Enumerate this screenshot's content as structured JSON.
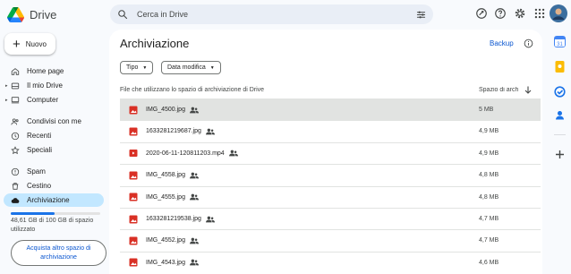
{
  "app": {
    "name": "Drive"
  },
  "search": {
    "placeholder": "Cerca in Drive"
  },
  "sidebar": {
    "new_label": "Nuovo",
    "items": [
      {
        "label": "Home page",
        "icon": "home-icon",
        "caret": false
      },
      {
        "label": "Il mio Drive",
        "icon": "my-drive-icon",
        "caret": true
      },
      {
        "label": "Computer",
        "icon": "computer-icon",
        "caret": true
      },
      {
        "label": "Condivisi con me",
        "icon": "shared-people-icon",
        "caret": false
      },
      {
        "label": "Recenti",
        "icon": "clock-icon",
        "caret": false
      },
      {
        "label": "Speciali",
        "icon": "star-icon",
        "caret": false
      },
      {
        "label": "Spam",
        "icon": "spam-icon",
        "caret": false
      },
      {
        "label": "Cestino",
        "icon": "trash-icon",
        "caret": false
      },
      {
        "label": "Archiviazione",
        "icon": "cloud-icon",
        "caret": false,
        "active": true
      }
    ],
    "storage": {
      "used_fraction": 0.486,
      "text": "48,61 GB di 100 GB di spazio utilizzato"
    },
    "buy_label": "Acquista altro spazio di archiviazione"
  },
  "main": {
    "title": "Archiviazione",
    "backup_label": "Backup",
    "filters": {
      "type_label": "Tipo",
      "modified_label": "Data modifica"
    },
    "columns": {
      "name": "File che utilizzano lo spazio di archiviazione di Drive",
      "size": "Spazio di arch"
    },
    "files": [
      {
        "name": "IMG_4500.jpg",
        "size": "5 MB",
        "type": "image",
        "shared": true,
        "selected": true
      },
      {
        "name": "1633281219687.jpg",
        "size": "4,9 MB",
        "type": "image",
        "shared": true
      },
      {
        "name": "2020-06-11-120811203.mp4",
        "size": "4,9 MB",
        "type": "video",
        "shared": true
      },
      {
        "name": "IMG_4558.jpg",
        "size": "4,8 MB",
        "type": "image",
        "shared": true
      },
      {
        "name": "IMG_4555.jpg",
        "size": "4,8 MB",
        "type": "image",
        "shared": true
      },
      {
        "name": "1633281219538.jpg",
        "size": "4,7 MB",
        "type": "image",
        "shared": true
      },
      {
        "name": "IMG_4552.jpg",
        "size": "4,7 MB",
        "type": "image",
        "shared": true
      },
      {
        "name": "IMG_4543.jpg",
        "size": "4,6 MB",
        "type": "image",
        "shared": true
      }
    ]
  },
  "colors": {
    "accent": "#0b57d0",
    "active_nav": "#c2e7ff",
    "file_red": "#d93025"
  }
}
